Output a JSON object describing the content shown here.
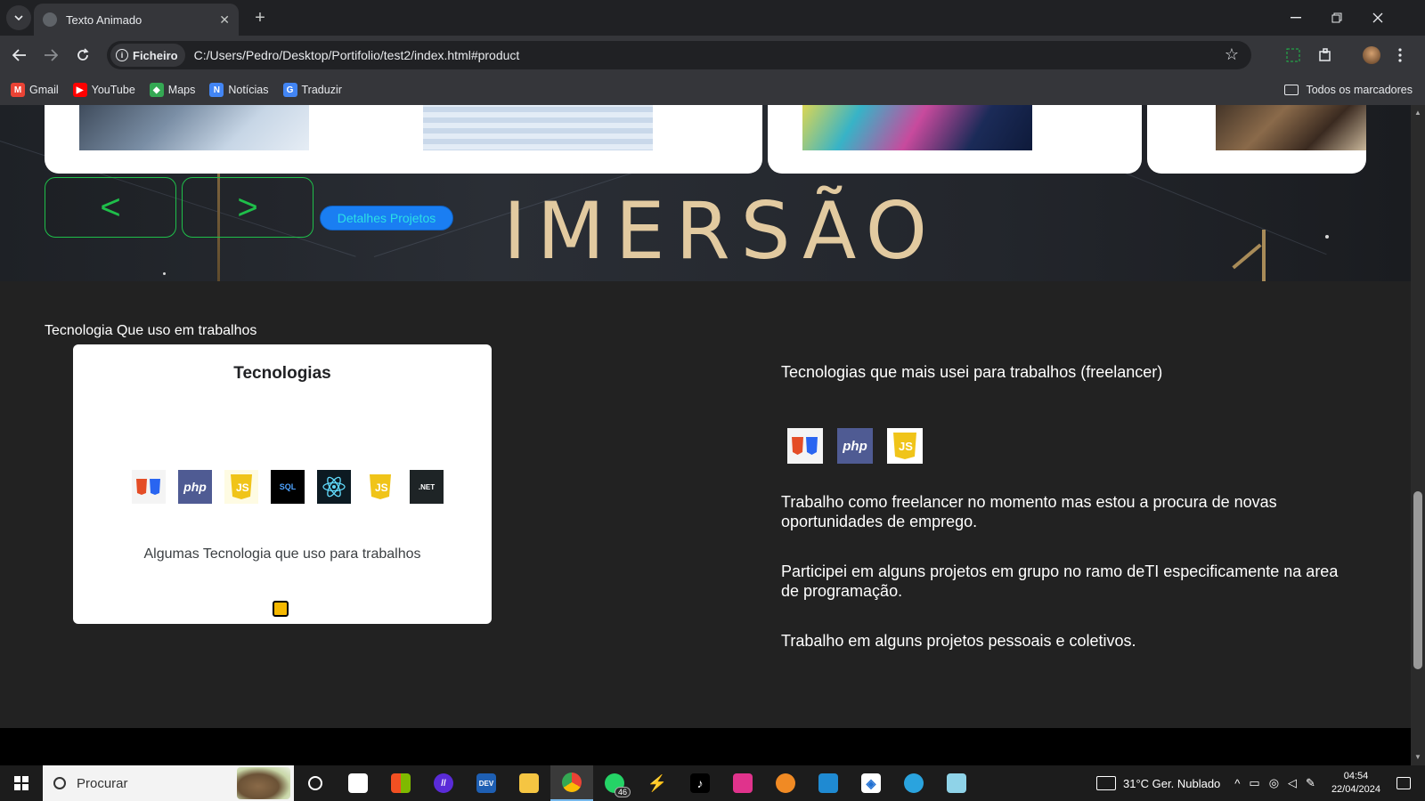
{
  "browser": {
    "tab_title": "Texto Animado",
    "tab_close": "✕",
    "new_tab": "+",
    "site_chip": "Ficheiro",
    "url": "C:/Users/Pedro/Desktop/Portifolio/test2/index.html#product",
    "bookmarks": [
      {
        "label": "Gmail",
        "icon": "gmail-icon",
        "color": "#ea4335"
      },
      {
        "label": "YouTube",
        "icon": "youtube-icon",
        "color": "#ff0000"
      },
      {
        "label": "Maps",
        "icon": "maps-icon",
        "color": "#34a853"
      },
      {
        "label": "Notícias",
        "icon": "news-icon",
        "color": "#4285f4"
      },
      {
        "label": "Traduzir",
        "icon": "translate-icon",
        "color": "#4285f4"
      }
    ],
    "all_bookmarks": "Todos os marcadores"
  },
  "hero": {
    "banner_text": "IMERSÃO",
    "prev_label": "<",
    "next_label": ">",
    "details_label": "Detalhes Projetos"
  },
  "main": {
    "section_title": "Tecnologia Que uso em trabalhos",
    "card_heading": "Tecnologias",
    "card_caption": "Algumas Tecnologia que uso para trabalhos",
    "card_icons": [
      {
        "name": "html-css-icon",
        "label": "HTML CSS"
      },
      {
        "name": "php-icon",
        "label": "php"
      },
      {
        "name": "javascript-icon",
        "label": "JS"
      },
      {
        "name": "sql-icon",
        "label": "SQL"
      },
      {
        "name": "react-icon",
        "label": "⚛"
      },
      {
        "name": "javascript-icon",
        "label": "JS"
      },
      {
        "name": "dotnet-icon",
        "label": ".NET"
      }
    ],
    "right_heading": "Tecnologias que mais usei para trabalhos (freelancer)",
    "right_icons": [
      {
        "name": "html-css-icon",
        "label": "HTML CSS"
      },
      {
        "name": "php-icon",
        "label": "php"
      },
      {
        "name": "javascript-icon",
        "label": "JS"
      }
    ],
    "paragraphs": [
      "Trabalho como freelancer no momento mas estou a procura de novas oportunidades de emprego.",
      "Participei em alguns projetos em grupo no ramo deTI especificamente na area de programação.",
      "Trabalho em alguns projetos pessoais e coletivos."
    ]
  },
  "taskbar": {
    "search_placeholder": "Procurar",
    "whatsapp_badge": "46",
    "weather": "31°C  Ger. Nublado",
    "time": "04:54",
    "date": "22/04/2024"
  }
}
